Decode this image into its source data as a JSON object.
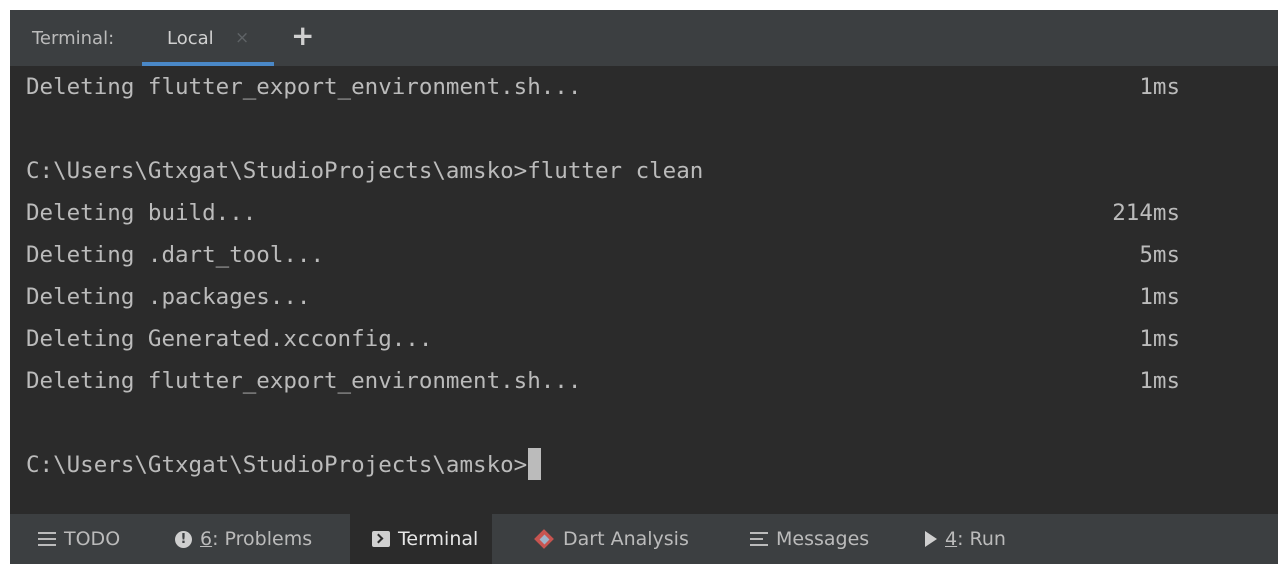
{
  "tabbar": {
    "label": "Terminal:",
    "tabs": [
      {
        "label": "Local",
        "close": "×"
      }
    ],
    "add": "+"
  },
  "terminal": {
    "lines": [
      {
        "text": "Deleting flutter_export_environment.sh...",
        "time": "1ms"
      },
      {
        "text": "",
        "time": ""
      },
      {
        "text": "C:\\Users\\Gtxgat\\StudioProjects\\amsko>flutter clean",
        "time": ""
      },
      {
        "text": "Deleting build...",
        "time": "214ms"
      },
      {
        "text": "Deleting .dart_tool...",
        "time": "5ms"
      },
      {
        "text": "Deleting .packages...",
        "time": "1ms"
      },
      {
        "text": "Deleting Generated.xcconfig...",
        "time": "1ms"
      },
      {
        "text": "Deleting flutter_export_environment.sh...",
        "time": "1ms"
      },
      {
        "text": "",
        "time": ""
      },
      {
        "text": "C:\\Users\\Gtxgat\\StudioProjects\\amsko>",
        "time": ""
      }
    ]
  },
  "toolbar": {
    "items": [
      {
        "icon": "list-icon",
        "mnemonic": "",
        "label": "TODO",
        "active": false
      },
      {
        "icon": "info-icon",
        "mnemonic": "6",
        "label": ": Problems",
        "active": false
      },
      {
        "icon": "terminal-icon",
        "mnemonic": "",
        "label": "Terminal",
        "active": true
      },
      {
        "icon": "dart-icon",
        "mnemonic": "",
        "label": "Dart Analysis",
        "active": false
      },
      {
        "icon": "messages-icon",
        "mnemonic": "",
        "label": "Messages",
        "active": false
      },
      {
        "icon": "run-icon",
        "mnemonic": "4",
        "label": ": Run",
        "active": false
      }
    ]
  },
  "colors": {
    "background": "#2b2b2b",
    "bars": "#3c3f41",
    "text": "#bbbbbb",
    "tab_underline": "#4a88c7"
  }
}
